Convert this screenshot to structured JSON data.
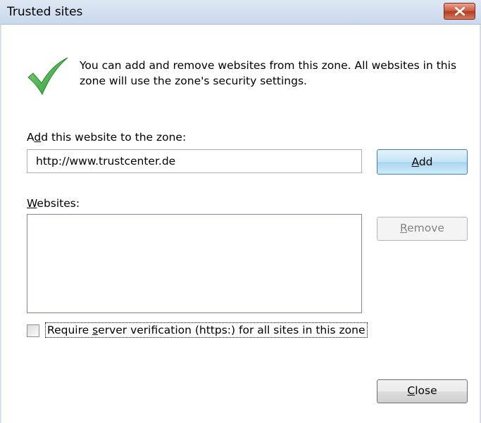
{
  "window": {
    "title": "Trusted sites"
  },
  "info": {
    "text": "You can add and remove websites from this zone. All websites in this zone will use the zone's security settings."
  },
  "add_site": {
    "label_pre": "A",
    "label_mnemonic": "d",
    "label_post": "d this website to the zone:",
    "value": "http://www.trustcenter.de",
    "button_mnemonic": "A",
    "button_rest": "dd"
  },
  "websites": {
    "label_mnemonic": "W",
    "label_rest": "ebsites:",
    "items": [],
    "remove_mnemonic": "R",
    "remove_rest": "emove"
  },
  "verification": {
    "checked": false,
    "label_pre": "Require ",
    "label_mnemonic": "s",
    "label_post": "erver verification (https:) for all sites in this zone"
  },
  "footer": {
    "close_mnemonic": "C",
    "close_rest": "lose"
  },
  "colors": {
    "check_green": "#3fae3f",
    "title_bar": "#c8d8ec",
    "close_red": "#c8553d"
  }
}
